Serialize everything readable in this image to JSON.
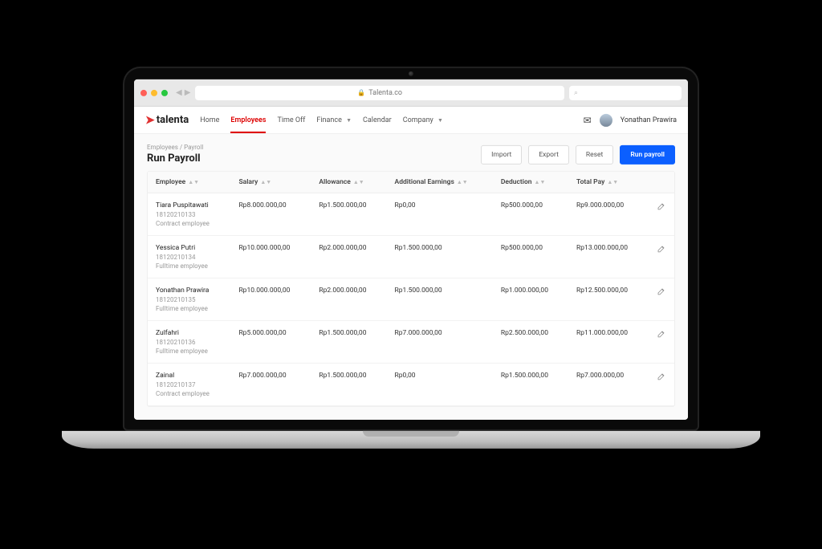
{
  "browser": {
    "url": "Talenta.co"
  },
  "brand": {
    "name": "talenta"
  },
  "nav": {
    "home": "Home",
    "employees": "Employees",
    "timeoff": "Time Off",
    "finance": "Finance",
    "calendar": "Calendar",
    "company": "Company"
  },
  "user": {
    "name": "Yonathan Prawira"
  },
  "page": {
    "breadcrumb": "Employees / Payroll",
    "title": "Run Payroll",
    "buttons": {
      "import": "Import",
      "export": "Export",
      "reset": "Reset",
      "run": "Run payroll"
    }
  },
  "columns": {
    "employee": "Employee",
    "salary": "Salary",
    "allowance": "Allowance",
    "additional": "Additional Earnings",
    "deduction": "Deduction",
    "total": "Total Pay"
  },
  "rows": [
    {
      "name": "Tiara Puspitawati",
      "id": "18120210133",
      "type": "Contract employee",
      "salary": "Rp8.000.000,00",
      "allowance": "Rp1.500.000,00",
      "additional": "Rp0,00",
      "deduction": "Rp500.000,00",
      "total": "Rp9.000.000,00"
    },
    {
      "name": "Yessica Putri",
      "id": "18120210134",
      "type": "Fulltime employee",
      "salary": "Rp10.000.000,00",
      "allowance": "Rp2.000.000,00",
      "additional": "Rp1.500.000,00",
      "deduction": "Rp500.000,00",
      "total": "Rp13.000.000,00"
    },
    {
      "name": "Yonathan Prawira",
      "id": "18120210135",
      "type": "Fulltime employee",
      "salary": "Rp10.000.000,00",
      "allowance": "Rp2.000.000,00",
      "additional": "Rp1.500.000,00",
      "deduction": "Rp1.000.000,00",
      "total": "Rp12.500.000,00"
    },
    {
      "name": "Zulfahri",
      "id": "18120210136",
      "type": "Fulltime employee",
      "salary": "Rp5.000.000,00",
      "allowance": "Rp1.500.000,00",
      "additional": "Rp7.000.000,00",
      "deduction": "Rp2.500.000,00",
      "total": "Rp11.000.000,00"
    },
    {
      "name": "Zainal",
      "id": "18120210137",
      "type": "Contract employee",
      "salary": "Rp7.000.000,00",
      "allowance": "Rp1.500.000,00",
      "additional": "Rp0,00",
      "deduction": "Rp1.500.000,00",
      "total": "Rp7.000.000,00"
    }
  ]
}
